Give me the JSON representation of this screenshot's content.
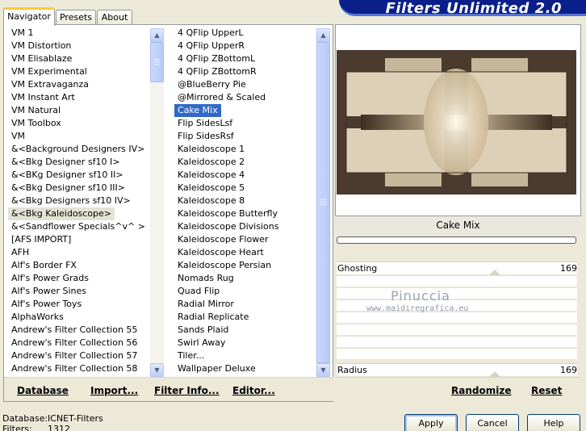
{
  "tabs": [
    {
      "label": "Navigator",
      "active": true
    },
    {
      "label": "Presets",
      "active": false
    },
    {
      "label": "About",
      "active": false
    }
  ],
  "banner_title": "Filters Unlimited 2.0",
  "categories": [
    "VM 1",
    "VM Distortion",
    "VM Elisablaze",
    "VM Experimental",
    "VM Extravaganza",
    "VM Instant Art",
    "VM Natural",
    "VM Toolbox",
    "VM",
    "&<Background Designers IV>",
    "&<Bkg Designer sf10 I>",
    "&<BKg Designer sf10 II>",
    "&<Bkg Designer sf10 III>",
    "&<Bkg Designers sf10 IV>",
    "&<Bkg Kaleidoscope>",
    "&<Sandflower Specials^v^ >",
    "[AFS IMPORT]",
    "AFH",
    "Alf's Border FX",
    "Alf's Power Grads",
    "Alf's Power Sines",
    "Alf's Power Toys",
    "AlphaWorks",
    "Andrew's Filter Collection 55",
    "Andrew's Filter Collection 56",
    "Andrew's Filter Collection 57",
    "Andrew's Filter Collection 58"
  ],
  "selected_category": "&<Bkg Kaleidoscope>",
  "filters": [
    "4 QFlip UpperL",
    "4 QFlip UpperR",
    "4 QFlip ZBottomL",
    "4 QFlip ZBottomR",
    "@BlueBerry Pie",
    "@Mirrored & Scaled",
    "Cake Mix",
    "Flip SidesLsf",
    "Flip SidesRsf",
    "Kaleidoscope 1",
    "Kaleidoscope 2",
    "Kaleidoscope 4",
    "Kaleidoscope 5",
    "Kaleidoscope 8",
    "Kaleidoscope Butterfly",
    "Kaleidoscope Divisions",
    "Kaleidoscope Flower",
    "Kaleidoscope Heart",
    "Kaleidoscope Persian",
    "Nomads Rug",
    "Quad Flip",
    "Radial Mirror",
    "Radial Replicate",
    "Sands Plaid",
    "Swirl Away",
    "Tiler...",
    "Wallpaper Deluxe"
  ],
  "selected_filter": "Cake Mix",
  "left_toolbar": {
    "database": "Database",
    "import": "Import...",
    "filter_info": "Filter Info...",
    "editor": "Editor..."
  },
  "preview_filter_name": "Cake Mix",
  "sliders": [
    {
      "label": "Ghosting",
      "value": "169"
    },
    {
      "label": "Radius",
      "value": "169"
    }
  ],
  "watermark": {
    "name": "Pinuccia",
    "url": "www.maidiregrafica.eu"
  },
  "right_toolbar": {
    "randomize": "Randomize",
    "reset": "Reset"
  },
  "status": {
    "database_label": "Database:",
    "database_value": "ICNET-Filters",
    "filters_label": "Filters:",
    "filters_value": "1312"
  },
  "buttons": {
    "apply": "Apply",
    "cancel": "Cancel",
    "help": "Help"
  },
  "colors": {
    "selection": "#316ac5",
    "banner": "#0a1f8a",
    "preview_bg": "#4b3a2e",
    "preview_light": "#d9cbb1"
  }
}
